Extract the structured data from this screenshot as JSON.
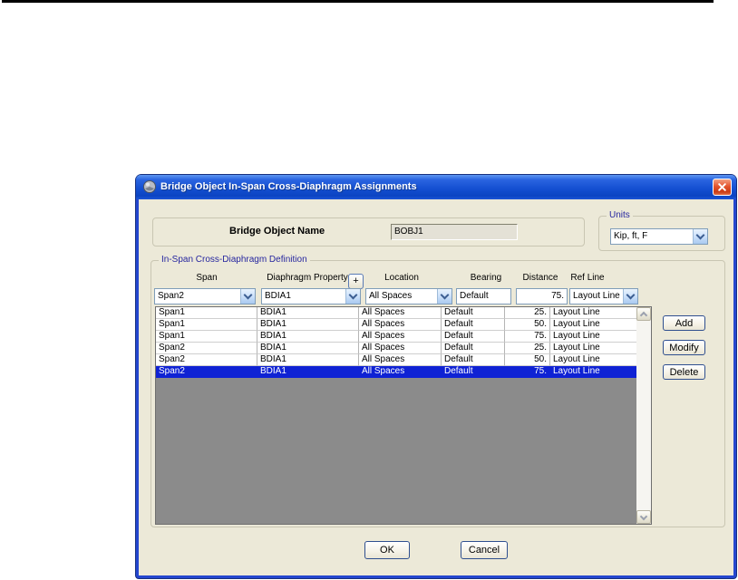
{
  "window": {
    "title": "Bridge Object In-Span Cross-Diaphragm Assignments"
  },
  "header": {
    "bridge_object_name_label": "Bridge Object Name",
    "bridge_object_name_value": "BOBJ1",
    "units_label": "Units",
    "units_value": "Kip, ft, F"
  },
  "definition": {
    "group_label": "In-Span Cross-Diaphragm Definition",
    "plus_button_label": "+",
    "columns": {
      "span": "Span",
      "diaphragm_property": "Diaphragm Property",
      "location": "Location",
      "bearing": "Bearing",
      "distance": "Distance",
      "ref_line": "Ref Line"
    },
    "entry": {
      "span": "Span2",
      "diaphragm_property": "BDIA1",
      "location": "All Spaces",
      "bearing": "Default",
      "distance": "75.",
      "ref_line": "Layout Line"
    },
    "rows": [
      {
        "span": "Span1",
        "diaphragm": "BDIA1",
        "location": "All Spaces",
        "bearing": "Default",
        "distance": "25.",
        "ref_line": "Layout Line"
      },
      {
        "span": "Span1",
        "diaphragm": "BDIA1",
        "location": "All Spaces",
        "bearing": "Default",
        "distance": "50.",
        "ref_line": "Layout Line"
      },
      {
        "span": "Span1",
        "diaphragm": "BDIA1",
        "location": "All Spaces",
        "bearing": "Default",
        "distance": "75.",
        "ref_line": "Layout Line"
      },
      {
        "span": "Span2",
        "diaphragm": "BDIA1",
        "location": "All Spaces",
        "bearing": "Default",
        "distance": "25.",
        "ref_line": "Layout Line"
      },
      {
        "span": "Span2",
        "diaphragm": "BDIA1",
        "location": "All Spaces",
        "bearing": "Default",
        "distance": "50.",
        "ref_line": "Layout Line"
      },
      {
        "span": "Span2",
        "diaphragm": "BDIA1",
        "location": "All Spaces",
        "bearing": "Default",
        "distance": "75.",
        "ref_line": "Layout Line"
      }
    ],
    "selected_row_index": 5,
    "buttons": {
      "add": "Add",
      "modify": "Modify",
      "delete": "Delete"
    }
  },
  "footer": {
    "ok": "OK",
    "cancel": "Cancel"
  },
  "colors": {
    "titlebar_blue": "#1550d2",
    "dialog_border_blue": "#2446cf",
    "body_beige": "#ece9d8",
    "selection_blue": "#0f22d4",
    "groupbox_caption_blue": "#26269f",
    "close_button_red": "#ca3c16",
    "table_empty_gray": "#8b8b8b"
  }
}
